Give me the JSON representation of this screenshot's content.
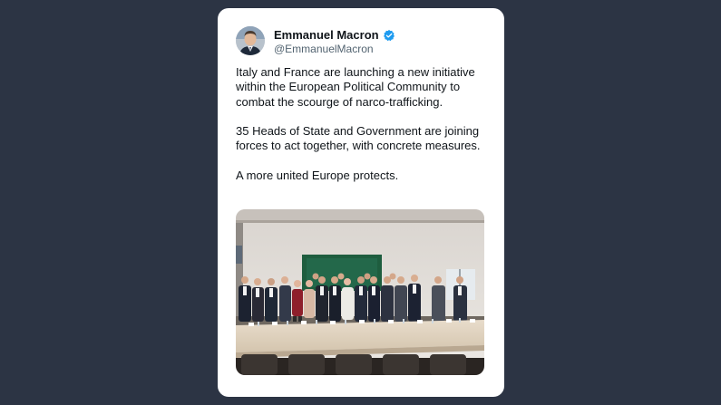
{
  "tweet": {
    "author_name": "Emmanuel Macron",
    "author_handle": "@EmmanuelMacron",
    "verified_icon": "verified-badge-icon",
    "paragraphs": [
      "Italy and France are launching a new initiative within the European Political Community to combat the scourge of narco-trafficking.",
      "35 Heads of State and Government are joining forces to act together, with concrete measures.",
      "A more united Europe protects."
    ]
  },
  "colors": {
    "page_background": "#2c3444",
    "card_background": "#ffffff",
    "verified_blue": "#1d9bf0",
    "text_primary": "#0f1419",
    "text_secondary": "#536471"
  }
}
